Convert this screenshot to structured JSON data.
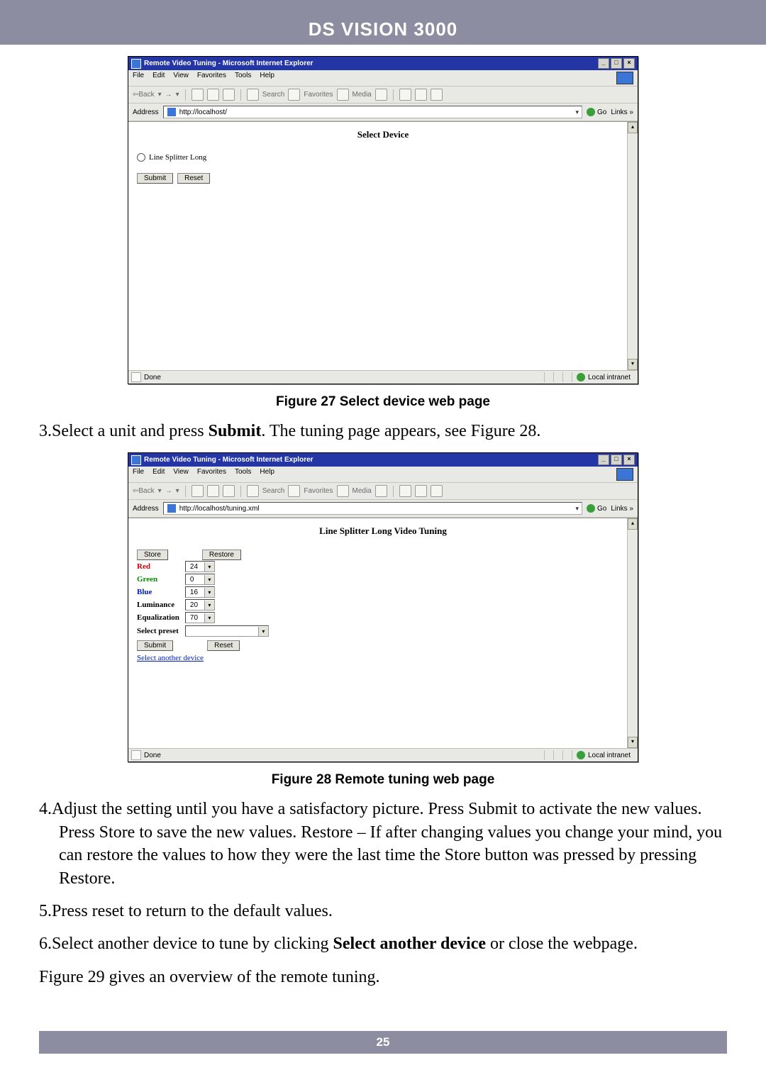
{
  "doc": {
    "header": "DS VISION 3000",
    "page_number": "25"
  },
  "fig27": {
    "caption": "Figure 27 Select device web page",
    "titlebar": "Remote Video Tuning - Microsoft Internet Explorer",
    "menu": [
      "File",
      "Edit",
      "View",
      "Favorites",
      "Tools",
      "Help"
    ],
    "toolbar": {
      "back": "Back",
      "search": "Search",
      "favorites": "Favorites",
      "media": "Media"
    },
    "address_label": "Address",
    "url": "http://localhost/",
    "go": "Go",
    "links": "Links »",
    "page_title": "Select Device",
    "radio_label": "Line Splitter Long",
    "submit": "Submit",
    "reset": "Reset",
    "status_done": "Done",
    "status_zone": "Local intranet"
  },
  "step3": {
    "prefix": "3.Select a unit and press ",
    "bold": "Submit",
    "suffix": ". The tuning page appears, see Figure 28."
  },
  "fig28": {
    "caption": "Figure 28 Remote tuning web page",
    "titlebar": "Remote Video Tuning - Microsoft Internet Explorer",
    "menu": [
      "File",
      "Edit",
      "View",
      "Favorites",
      "Tools",
      "Help"
    ],
    "toolbar": {
      "back": "Back",
      "search": "Search",
      "favorites": "Favorites",
      "media": "Media"
    },
    "address_label": "Address",
    "url": "http://localhost/tuning.xml",
    "go": "Go",
    "links": "Links »",
    "page_title": "Line Splitter Long Video Tuning",
    "store": "Store",
    "restore": "Restore",
    "rows": {
      "red": {
        "label": "Red",
        "value": "24"
      },
      "green": {
        "label": "Green",
        "value": "0"
      },
      "blue": {
        "label": "Blue",
        "value": "16"
      },
      "lum": {
        "label": "Luminance",
        "value": "20"
      },
      "eq": {
        "label": "Equalization",
        "value": "70"
      },
      "preset": {
        "label": "Select preset",
        "value": ""
      }
    },
    "submit": "Submit",
    "reset": "Reset",
    "another": "Select another device",
    "status_done": "Done",
    "status_zone": "Local intranet"
  },
  "step4": "4.Adjust the setting until you have a satisfactory picture. Press Submit to activate the new values. Press Store to save the new values. Restore – If after changing values you change your mind, you can restore the values to how they were the last time the Store button was pressed by pressing Restore.",
  "step5": "5.Press reset to return to the default values.",
  "step6": {
    "prefix": "6.Select another device to tune by clicking ",
    "bold": "Select another device",
    "suffix": " or close the webpage."
  },
  "closing": "Figure 29 gives an overview of the remote tuning."
}
